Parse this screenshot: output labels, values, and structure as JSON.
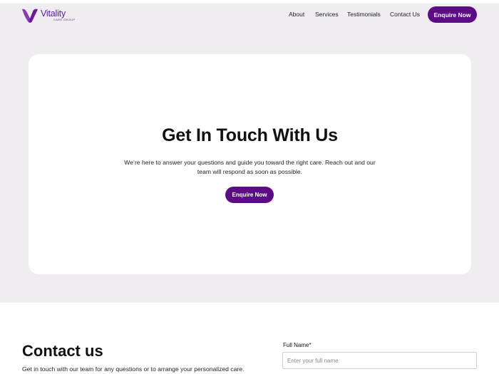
{
  "brand": {
    "name": "Vitality",
    "subtitle": "CARE GROUP",
    "color": "#5c0d86"
  },
  "nav": {
    "items": [
      {
        "label": "About"
      },
      {
        "label": "Services"
      },
      {
        "label": "Testimonials"
      },
      {
        "label": "Contact Us"
      }
    ],
    "cta_label": "Enquire Now"
  },
  "hero": {
    "title": "Get In Touch With Us",
    "description": "We’re here to answer your questions and guide you toward the right care. Reach out and our team will respond as soon as possible.",
    "cta_label": "Enquire Now"
  },
  "contact": {
    "title": "Contact us",
    "description": "Get in touch with our team for any questions or to arrange your personalized care.",
    "full_name": {
      "label": "Full Name*",
      "placeholder": "Enter your full name",
      "value": ""
    }
  },
  "colors": {
    "background_band": "#efedf0",
    "accent": "#5c0d86",
    "card": "#ffffff"
  }
}
